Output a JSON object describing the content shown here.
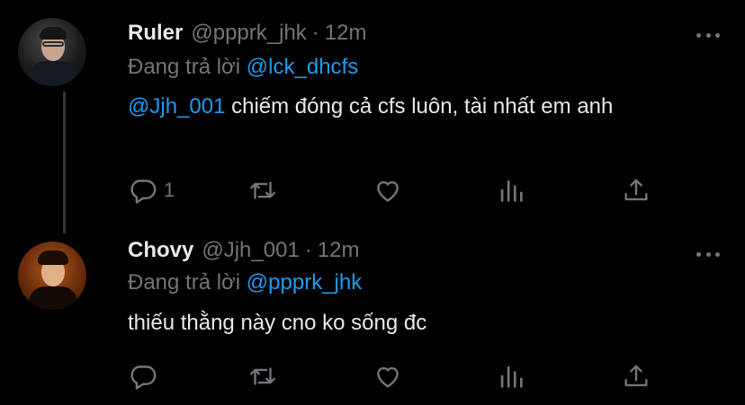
{
  "tweets": [
    {
      "name": "Ruler",
      "handle": "@ppprk_jhk",
      "separator": "·",
      "time": "12m",
      "reply_prefix": "Đang trả lời",
      "reply_to": "@lck_dhcfs",
      "mention": "@Jjh_001",
      "text": " chiếm đóng cả cfs luôn, tài nhất em anh",
      "reply_count": "1",
      "avatar_icon": "avatar-ruler",
      "more_icon": "more-icon"
    },
    {
      "name": "Chovy",
      "handle": "@Jjh_001",
      "separator": "·",
      "time": "12m",
      "reply_prefix": "Đang trả lời",
      "reply_to": "@ppprk_jhk",
      "text": "thiếu thằng này cno ko sống đc",
      "reply_count": "",
      "avatar_icon": "avatar-chovy",
      "more_icon": "more-icon"
    }
  ],
  "colors": {
    "background": "#000000",
    "text_primary": "#e7e9ea",
    "text_secondary": "#71767b",
    "link": "#1d9bf0",
    "thread_line": "#333639"
  },
  "action_icons": [
    "reply-icon",
    "retweet-icon",
    "like-icon",
    "views-icon",
    "share-icon"
  ]
}
